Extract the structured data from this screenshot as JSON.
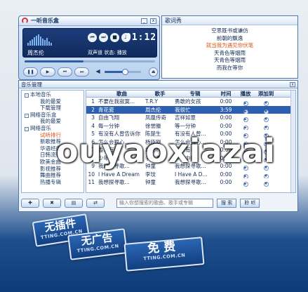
{
  "player": {
    "title": "一听音乐盒",
    "artist": "周杰伦",
    "time": "01:12",
    "status_label": "双声道  状态: 播放",
    "progress": 0.45,
    "volume": 0.55,
    "controls": {
      "prev": "⏮",
      "next": "⏭",
      "stop": "■",
      "mute": "♪",
      "pause": "❚❚",
      "play": "▶",
      "eject": "⏏",
      "volume_icon": "◀"
    }
  },
  "lyrics": {
    "title": "歌词秀",
    "lines": [
      "空思既书或谦仿",
      "前朝的飘逸",
      "就当我为遇见你伏笔",
      "天青色等烟雨",
      "天青色等烟雨",
      "而我在等你"
    ],
    "current_index": 2,
    "highlight_color": "#d8551b"
  },
  "manager": {
    "title": "音乐管理",
    "tree": [
      {
        "label": "本地音乐",
        "level": 0,
        "toggle": "-"
      },
      {
        "label": "我的最爱",
        "level": 1
      },
      {
        "label": "下载管理",
        "level": 1
      },
      {
        "label": "网络音乐盒",
        "level": 0,
        "toggle": "-"
      },
      {
        "label": "我的最爱",
        "level": 1
      },
      {
        "label": "网络音乐",
        "level": 0,
        "toggle": "-"
      },
      {
        "label": "试听排行",
        "level": 1,
        "selected": true
      },
      {
        "label": "新歌推荐",
        "level": 1
      },
      {
        "label": "华语经典",
        "level": 1
      },
      {
        "label": "日韩流行",
        "level": 1
      },
      {
        "label": "欧美金曲",
        "level": 1
      },
      {
        "label": "影视推荐",
        "level": 1
      },
      {
        "label": "舞曲推荐",
        "level": 1
      },
      {
        "label": "热播专辑",
        "level": 1
      }
    ],
    "columns": {
      "song": "歌曲",
      "artist": "歌手",
      "album": "专辑",
      "time": "时间",
      "play": "播放",
      "add": "添加到"
    },
    "rows": [
      {
        "num": "1",
        "song": "不要在我寂寞...",
        "artist": "T.R.Y",
        "album": "勇敢的女孩",
        "time": "0:00"
      },
      {
        "num": "2",
        "song": "青花瓷",
        "artist": "周杰伦",
        "album": "我很忙",
        "time": "3:59",
        "selected": true
      },
      {
        "num": "3",
        "song": "自由飞翔",
        "artist": "凤凰传奇",
        "album": "吉祥如意",
        "time": "0:00"
      },
      {
        "num": "4",
        "song": "每一分钟",
        "artist": "徐誉滕",
        "album": "等一分钟",
        "time": "0:00"
      },
      {
        "num": "5",
        "song": "有没有人曾告诉你",
        "artist": "陈楚生",
        "album": "有没有人曾...",
        "time": "0:00"
      },
      {
        "num": "6",
        "song": "怎么会狠心...",
        "artist": "杨臣刚",
        "album": "怎么会狠心...",
        "time": "0:00"
      },
      {
        "num": "7",
        "song": "香水有毒",
        "artist": "胡杨林",
        "album": "香水有毒",
        "time": "0:00"
      },
      {
        "num": "8",
        "song": "少年中国",
        "artist": "李宇春",
        "album": "少年中国",
        "time": "0:00"
      },
      {
        "num": "9",
        "song": "我想探寻歌...",
        "artist": "钟童",
        "album": "我想探寻歌...",
        "time": "0:00"
      },
      {
        "num": "10",
        "song": "I Have A Dream",
        "artist": "李玟",
        "album": "I Have A D...",
        "time": "0:00"
      },
      {
        "num": "11",
        "song": "我想探寻歌...",
        "artist": "钟童",
        "album": "我想探寻歌...",
        "time": "0:00"
      }
    ],
    "toolbar": {
      "add": "✚",
      "delete": "✖",
      "mode": "▤",
      "loop": "⇄"
    },
    "search": {
      "placeholder": "输入你想搜索的歌曲、歌手或专辑",
      "search_label": "搜 索",
      "listen_label": "聆 听"
    }
  },
  "watermark": "ouyaoxiazai",
  "badges": [
    {
      "big": "无插件",
      "small": "TTING.COM.CN"
    },
    {
      "big": "无广告",
      "small": "TTING.COM.CN"
    },
    {
      "big": "免费",
      "small": "TTING.COM.CN"
    }
  ]
}
